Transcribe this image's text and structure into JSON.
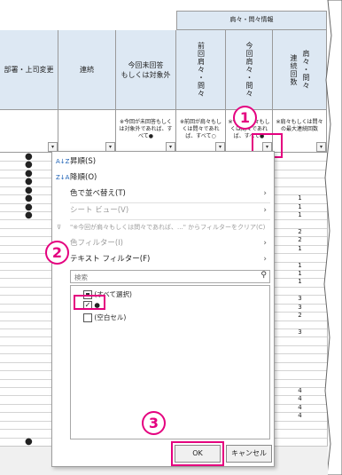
{
  "sheet": {
    "group_header": "肩々・問々情報",
    "columns": [
      {
        "label": "部署・上司変更"
      },
      {
        "label": "連続"
      },
      {
        "label": "今回未回答\nもしくは対象外"
      },
      {
        "label": "前回肩々・問々"
      },
      {
        "label": "今回肩々・問々"
      },
      {
        "label": "連続回数",
        "sub": "肩々・問々"
      }
    ],
    "notes": {
      "col3": "※今回が未回答もしくは対象外であれば、すべて●",
      "col4": "※前回が肩々もしくは問々であれば、すべて○",
      "col5": "※今回が肩々もしくは問々であれば、すべて●",
      "col6": "※肩々もしくは問々の最大連続回数"
    },
    "col1_rows": [
      "●",
      "●",
      "●",
      "●",
      "●",
      "●",
      "●",
      "●",
      "",
      "",
      "",
      "",
      "",
      "",
      "",
      "",
      "",
      "",
      "",
      "",
      "",
      "",
      "",
      "",
      "",
      "",
      "",
      "",
      "",
      "",
      "",
      "",
      "",
      "",
      "●"
    ],
    "col6_rows": [
      "",
      "",
      "",
      "",
      "",
      "1",
      "1",
      "1",
      "",
      "2",
      "2",
      "1",
      "",
      "1",
      "1",
      "1",
      "",
      "3",
      "3",
      "2",
      "",
      "3",
      "",
      "",
      "",
      "",
      "",
      "",
      "4",
      "4",
      "4",
      "4",
      "",
      "",
      ""
    ]
  },
  "filter_menu": {
    "sort_asc": "昇順(S)",
    "sort_desc": "降順(O)",
    "sort_color": "色で並べ替え(T)",
    "sheet_view": "シート ビュー(V)",
    "clear_filter": "\"※今回が肩々もしくは問々であれば、...\" からフィルターをクリア(C)",
    "color_filter": "色フィルター(I)",
    "text_filter": "テキスト フィルター(F)",
    "search_placeholder": "検索",
    "items": [
      {
        "label": "(すべて選択)",
        "state": "partial"
      },
      {
        "label": "●",
        "state": "checked"
      },
      {
        "label": "(空白セル)",
        "state": "unchecked"
      }
    ],
    "ok_label": "OK",
    "cancel_label": "キャンセル"
  },
  "annotations": {
    "step1": "1",
    "step2": "2",
    "step3": "3"
  },
  "colors": {
    "accent": "#e4007f",
    "header_bg": "#dde8f3"
  }
}
